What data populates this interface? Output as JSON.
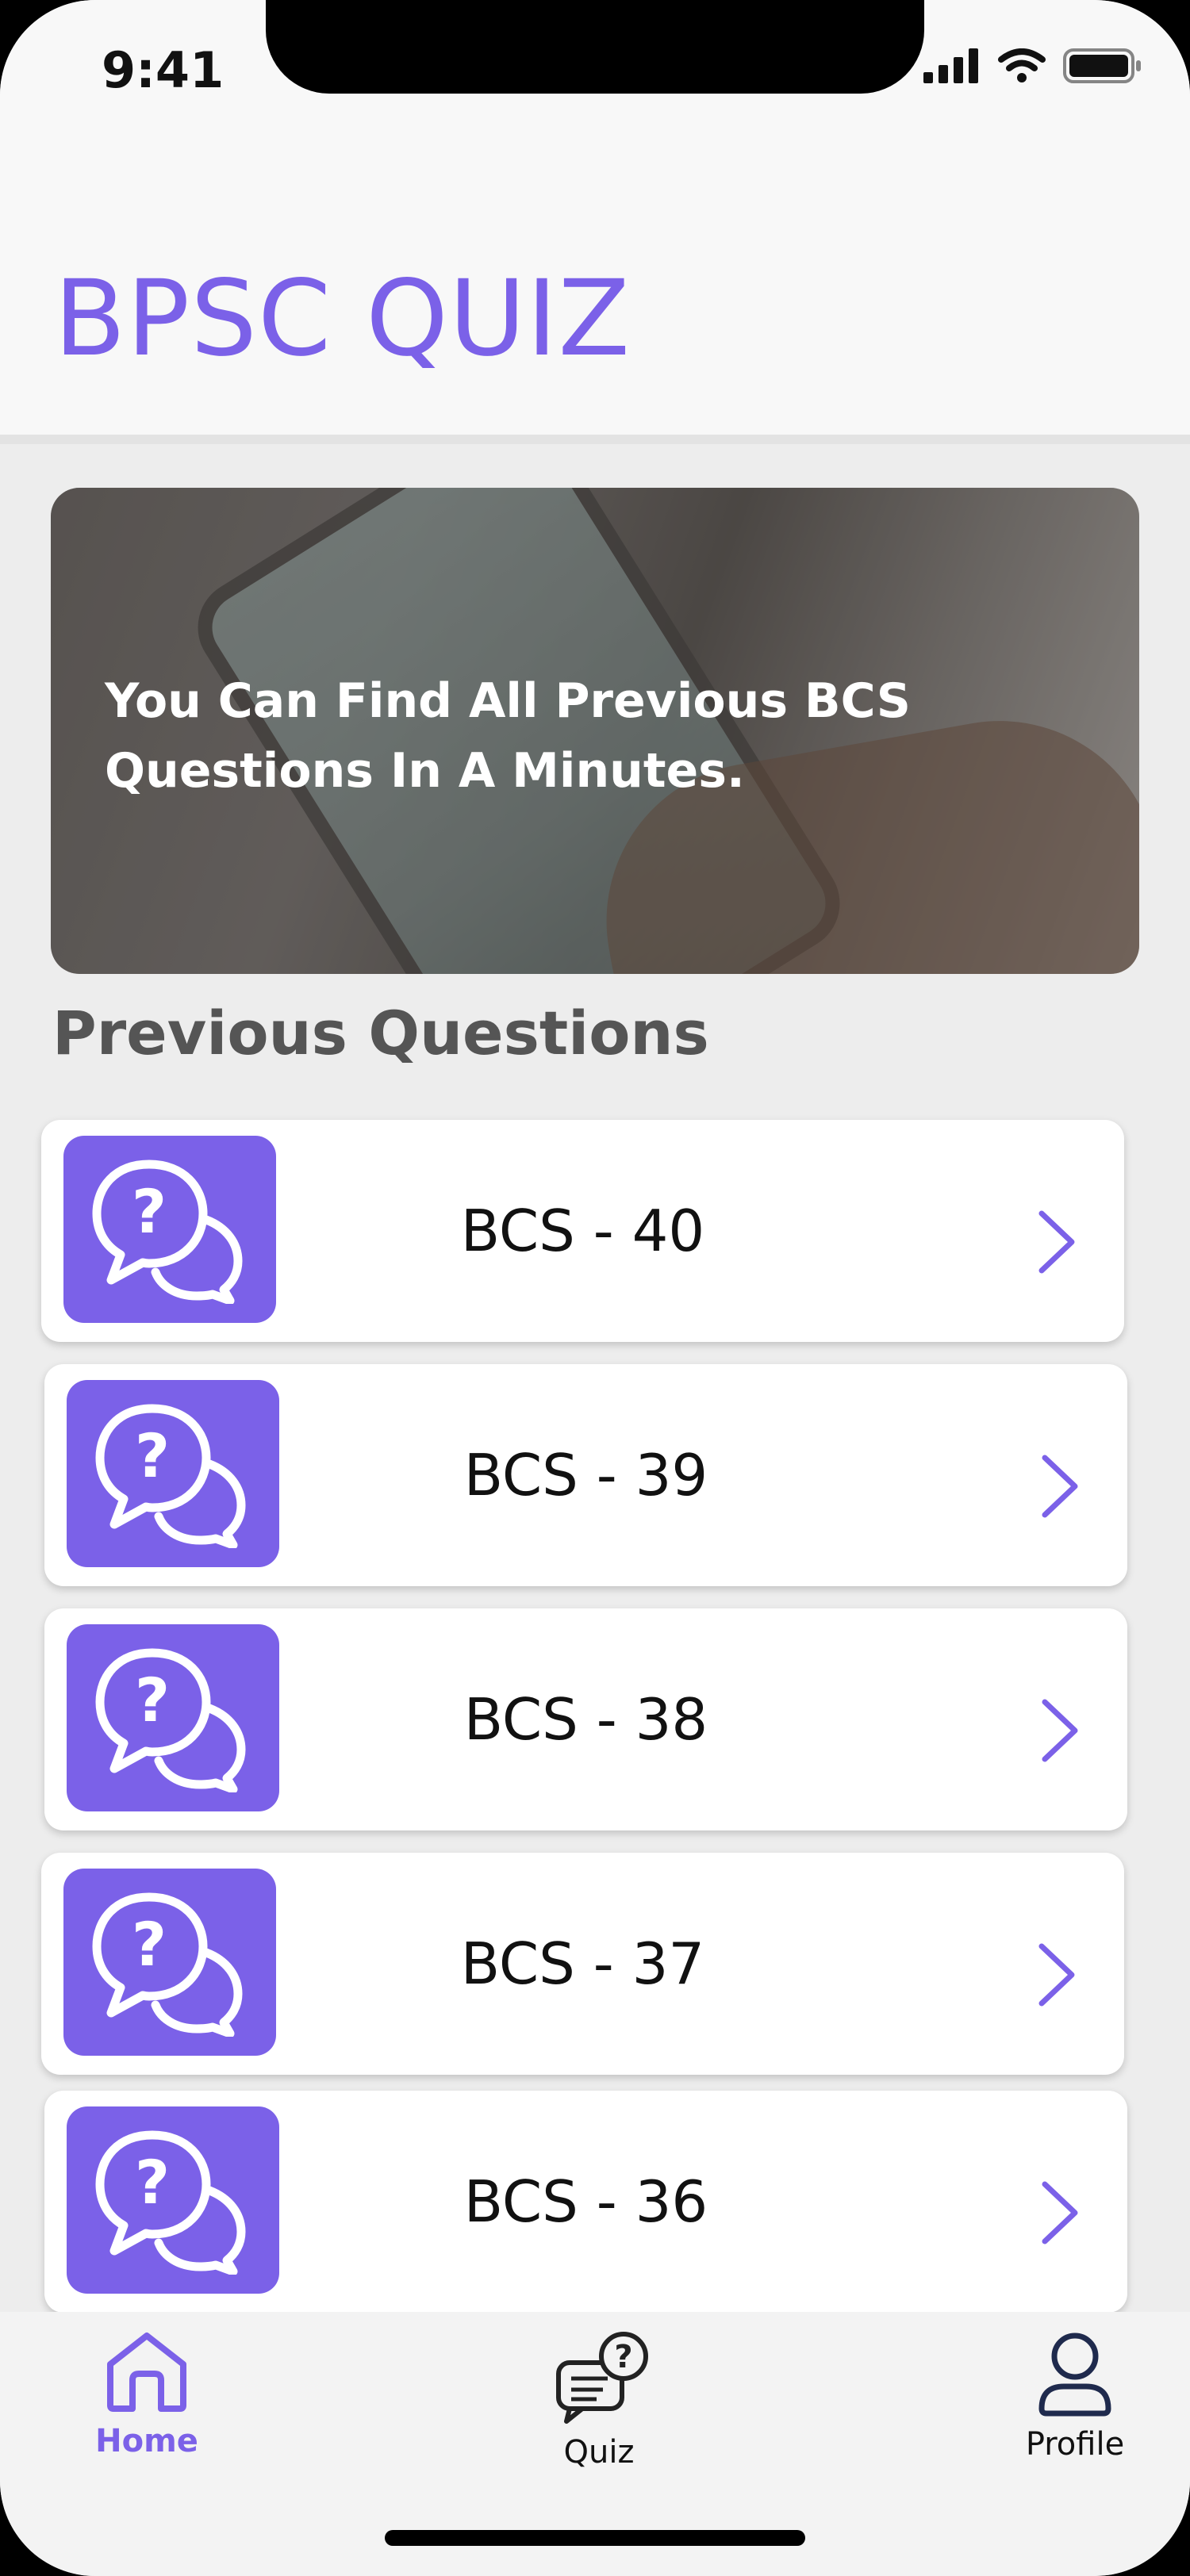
{
  "status_bar": {
    "time": "9:41"
  },
  "header": {
    "title": "BPSC QUIZ"
  },
  "banner": {
    "text": "You Can Find All Previous BCS Questions In A Minutes."
  },
  "section": {
    "title": "Previous Questions"
  },
  "questions": [
    {
      "label": "BCS - 40"
    },
    {
      "label": "BCS - 39"
    },
    {
      "label": "BCS - 38"
    },
    {
      "label": "BCS - 37"
    },
    {
      "label": "BCS - 36"
    }
  ],
  "nav": {
    "home": {
      "label": "Home",
      "icon": "home-icon",
      "active": true
    },
    "quiz": {
      "label": "Quiz",
      "icon": "quiz-chat-icon"
    },
    "profile": {
      "label": "Profile",
      "icon": "user-icon"
    }
  },
  "colors": {
    "accent": "#7b61e8",
    "background": "#ededed"
  }
}
